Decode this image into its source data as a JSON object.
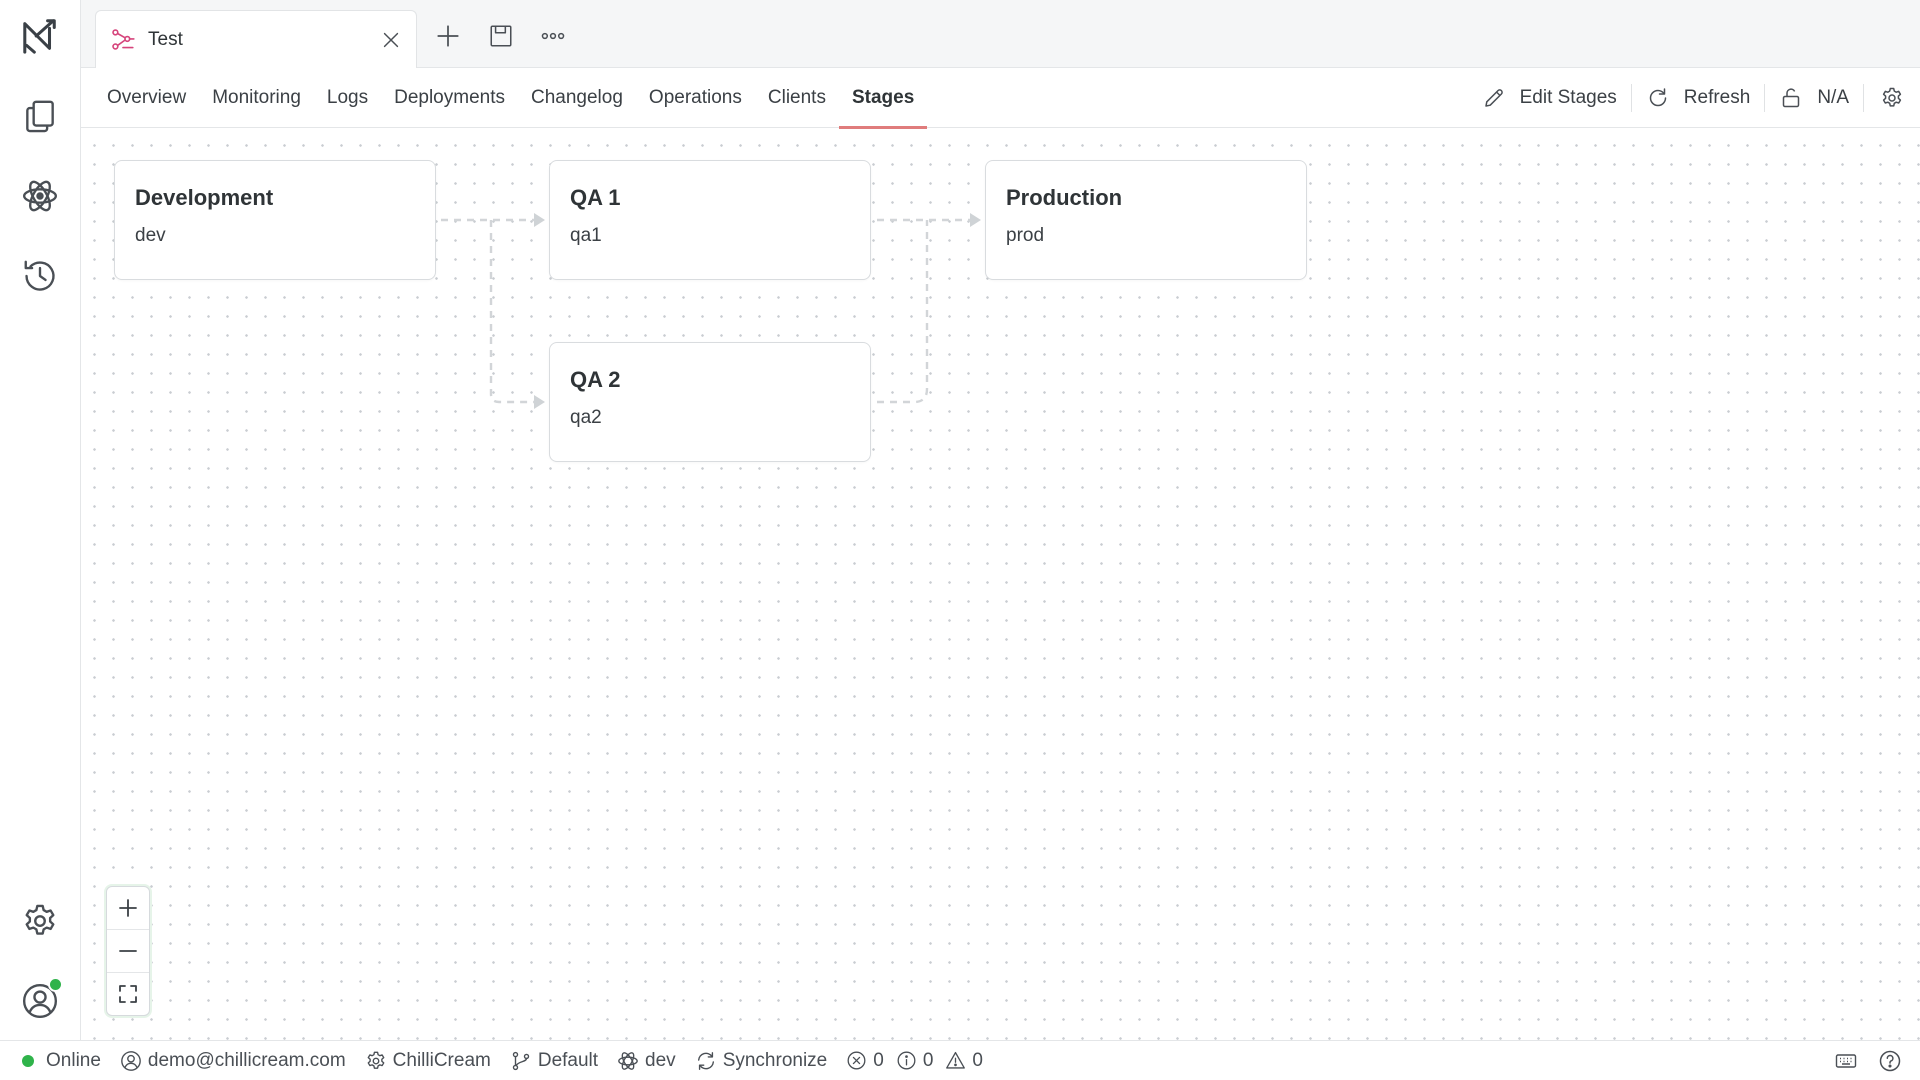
{
  "rail": {
    "items": [
      {
        "name": "app-logo-icon"
      },
      {
        "name": "documents-icon"
      },
      {
        "name": "api-icon"
      },
      {
        "name": "history-icon"
      },
      {
        "name": "settings-icon"
      },
      {
        "name": "account-icon"
      }
    ],
    "status_color": "#2fb34a"
  },
  "tabbar": {
    "document_tab": {
      "title": "Test",
      "icon": "schema-icon"
    }
  },
  "subnav": {
    "tabs": [
      {
        "label": "Overview"
      },
      {
        "label": "Monitoring"
      },
      {
        "label": "Logs"
      },
      {
        "label": "Deployments"
      },
      {
        "label": "Changelog"
      },
      {
        "label": "Operations"
      },
      {
        "label": "Clients"
      },
      {
        "label": "Stages"
      }
    ],
    "active_tab": "Stages",
    "actions": {
      "edit_label": "Edit Stages",
      "refresh_label": "Refresh",
      "lock_label": "N/A"
    },
    "accent_color": "#e07c7c"
  },
  "stages": {
    "development": {
      "name": "Development",
      "slug": "dev"
    },
    "qa1": {
      "name": "QA 1",
      "slug": "qa1"
    },
    "qa2": {
      "name": "QA 2",
      "slug": "qa2"
    },
    "production": {
      "name": "Production",
      "slug": "prod"
    }
  },
  "statusbar": {
    "connection": "Online",
    "user": "demo@chillicream.com",
    "workspace": "ChilliCream",
    "branch": "Default",
    "environment": "dev",
    "sync": "Synchronize",
    "errors": "0",
    "infos": "0",
    "warnings": "0"
  }
}
